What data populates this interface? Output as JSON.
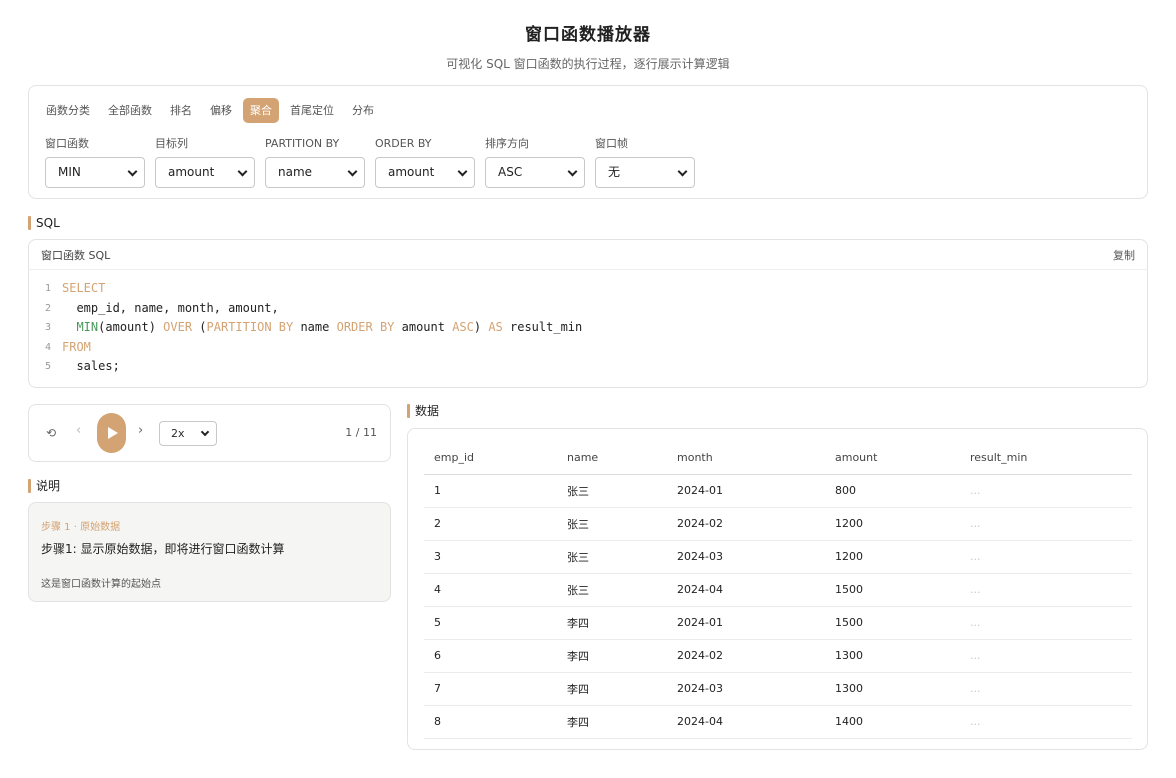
{
  "header": {
    "title": "窗口函数播放器",
    "subtitle": "可视化 SQL 窗口函数的执行过程，逐行展示计算逻辑"
  },
  "tabs": [
    {
      "label": "函数分类",
      "active": false
    },
    {
      "label": "全部函数",
      "active": false
    },
    {
      "label": "排名",
      "active": false
    },
    {
      "label": "偏移",
      "active": false
    },
    {
      "label": "聚合",
      "active": true
    },
    {
      "label": "首尾定位",
      "active": false
    },
    {
      "label": "分布",
      "active": false
    }
  ],
  "selectors": [
    {
      "label": "窗口函数",
      "value": "MIN"
    },
    {
      "label": "目标列",
      "value": "amount"
    },
    {
      "label": "PARTITION BY",
      "value": "name"
    },
    {
      "label": "ORDER BY",
      "value": "amount"
    },
    {
      "label": "排序方向",
      "value": "ASC"
    },
    {
      "label": "窗口帧",
      "value": "无"
    }
  ],
  "sql": {
    "section_label": "SQL",
    "box_title": "窗口函数 SQL",
    "copy_label": "复制",
    "line_numbers": [
      "1",
      "2",
      "3",
      "4",
      "5"
    ],
    "line1": {
      "kw": "SELECT"
    },
    "line2": {
      "text": "  emp_id, name, month, amount,"
    },
    "line3": {
      "indent": "  ",
      "fn": "MIN",
      "t1": "(amount) ",
      "kw1": "OVER",
      "t2": " (",
      "kw2": "PARTITION BY",
      "t3": " name ",
      "kw3": "ORDER BY",
      "t4": " amount ",
      "kw4": "ASC",
      "t5": ") ",
      "kw5": "AS",
      "t6": " result_min"
    },
    "line4": {
      "kw": "FROM"
    },
    "line5": {
      "text": "  sales;"
    }
  },
  "player": {
    "reset_glyph": "⟲",
    "prev_glyph": "‹",
    "next_glyph": "›",
    "speed": "2x",
    "step_counter": "1 / 11"
  },
  "explain": {
    "section_label": "说明",
    "step_title": "步骤 1 · 原始数据",
    "main_text": "步骤1: 显示原始数据，即将进行窗口函数计算",
    "note": "这是窗口函数计算的起始点"
  },
  "data": {
    "section_label": "数据",
    "columns": [
      "emp_id",
      "name",
      "month",
      "amount",
      "result_min"
    ],
    "rows": [
      [
        "1",
        "张三",
        "2024-01",
        "800",
        "..."
      ],
      [
        "2",
        "张三",
        "2024-02",
        "1200",
        "..."
      ],
      [
        "3",
        "张三",
        "2024-03",
        "1200",
        "..."
      ],
      [
        "4",
        "张三",
        "2024-04",
        "1500",
        "..."
      ],
      [
        "5",
        "李四",
        "2024-01",
        "1500",
        "..."
      ],
      [
        "6",
        "李四",
        "2024-02",
        "1300",
        "..."
      ],
      [
        "7",
        "李四",
        "2024-03",
        "1300",
        "..."
      ],
      [
        "8",
        "李四",
        "2024-04",
        "1400",
        "..."
      ]
    ]
  },
  "colors": {
    "accent": "#d4a373",
    "function_green": "#4b9a5a"
  }
}
